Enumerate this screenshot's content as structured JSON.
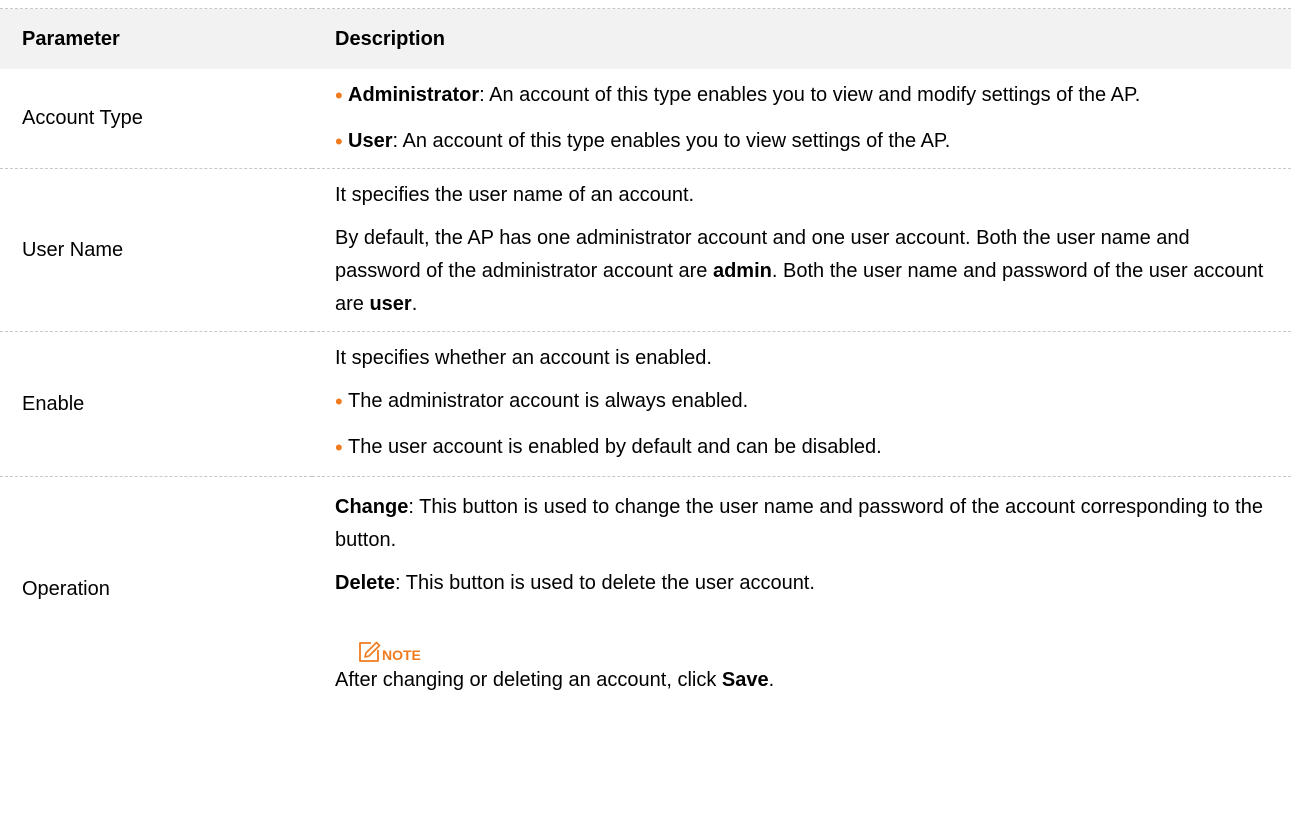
{
  "table": {
    "header": {
      "parameter": "Parameter",
      "description": "Description"
    },
    "rows": {
      "account_type": {
        "name": "Account Type",
        "bullet1": {
          "bold": "Administrator",
          "text": ": An account of this type enables you to view and modify settings of the AP."
        },
        "bullet2": {
          "bold": "User",
          "text": ": An account of this type enables you to view settings of the AP."
        }
      },
      "user_name": {
        "name": "User Name",
        "line1": "It specifies the user name of an account.",
        "para_a": "By default, the AP has one administrator account and one user account. Both the user name and password of the administrator account are ",
        "para_b": "admin",
        "para_c": ". Both the user name and password of the user account are ",
        "para_d": "user",
        "para_e": "."
      },
      "enable": {
        "name": "Enable",
        "line1": "It specifies whether an account is enabled.",
        "bullet1": "The administrator account is always enabled.",
        "bullet2": "The user account is enabled by default and can be disabled."
      },
      "operation": {
        "name": "Operation",
        "change_bold": "Change",
        "change_text": ": This button is used to change the user name and password of the account corresponding to the button.",
        "delete_bold": "Delete",
        "delete_text": ": This button is used to delete the user account.",
        "note_label": "NOTE",
        "note_text_a": "After changing or deleting an account, click ",
        "note_text_b": "Save",
        "note_text_c": "."
      }
    }
  },
  "colors": {
    "accent": "#f07b1f",
    "header_bg": "#f2f2f2",
    "divider": "#c8c8c8"
  },
  "icons": {
    "bullet": "bullet-dot",
    "note": "note-pencil-icon"
  }
}
